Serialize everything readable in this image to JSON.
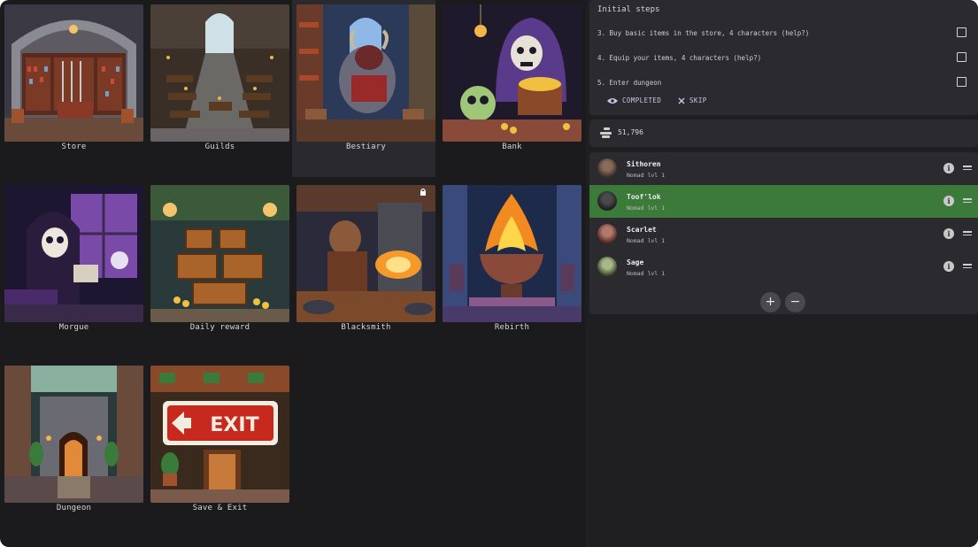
{
  "tiles": [
    {
      "label": "Store",
      "name": "store"
    },
    {
      "label": "Guilds",
      "name": "guilds"
    },
    {
      "label": "Bestiary",
      "name": "bestiary"
    },
    {
      "label": "Bank",
      "name": "bank"
    },
    {
      "label": "Morgue",
      "name": "morgue"
    },
    {
      "label": "Daily reward",
      "name": "daily-reward"
    },
    {
      "label": "Blacksmith",
      "name": "blacksmith",
      "locked": true
    },
    {
      "label": "Rebirth",
      "name": "rebirth"
    },
    {
      "label": "Dungeon",
      "name": "dungeon"
    },
    {
      "label": "Save & Exit",
      "name": "save-exit"
    }
  ],
  "steps": {
    "title": "Initial steps",
    "items": [
      "3. Buy basic items in the store, 4 characters (help?)",
      "4. Equip your items, 4 characters (help?)",
      "5. Enter dungeon"
    ],
    "completed_label": "COMPLETED",
    "skip_label": "SKIP"
  },
  "gold": {
    "value": "51,796",
    "icon": "gold-coins-icon"
  },
  "party": [
    {
      "name": "Sithoren",
      "sub": "Nomad lvl 1",
      "selected": false
    },
    {
      "name": "Toof'lok",
      "sub": "Nomad lvl 1",
      "selected": true
    },
    {
      "name": "Scarlet",
      "sub": "Nomad lvl 1",
      "selected": false
    },
    {
      "name": "Sage",
      "sub": "Nomad lvl 1",
      "selected": false
    }
  ],
  "party_controls": {
    "add": "+",
    "remove": "−"
  },
  "colors": {
    "selected": "#3c7a3a",
    "accent": "#c9c7f0",
    "background": "#1b1a1d"
  }
}
